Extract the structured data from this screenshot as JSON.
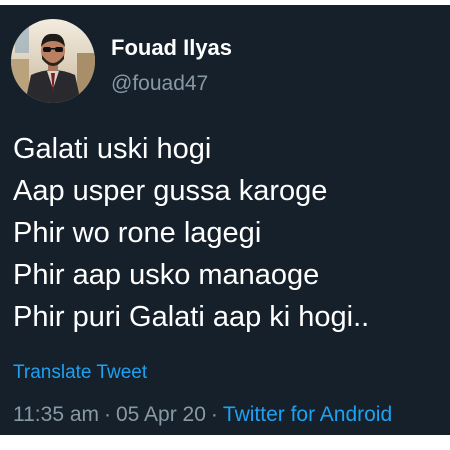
{
  "tweet": {
    "author": {
      "display_name": "Fouad Ilyas",
      "handle": "@fouad47"
    },
    "lines": [
      "Galati uski hogi",
      "Aap usper gussa karoge",
      "Phir wo rone lagegi",
      "Phir aap usko manaoge",
      "Phir puri Galati aap ki hogi.."
    ],
    "translate_label": "Translate Tweet",
    "meta": {
      "time": "11:35 am",
      "separator": "·",
      "date": "05 Apr 20",
      "source": "Twitter for Android"
    }
  },
  "colors": {
    "background": "#15202b",
    "text": "#ffffff",
    "secondary": "#8899a6",
    "accent": "#1da1f2"
  }
}
